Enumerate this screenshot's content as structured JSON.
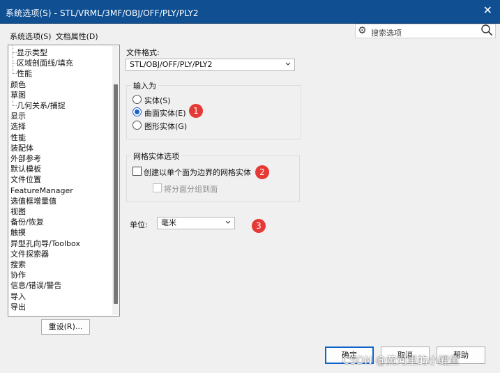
{
  "window": {
    "title": "系统选项(S) - STL/VRML/3MF/OBJ/OFF/PLY/PLY2",
    "close_glyph": "✕"
  },
  "tabs": [
    "系统选项(S)",
    "文档属性(D)"
  ],
  "search": {
    "placeholder": "搜索选项"
  },
  "tree": {
    "items": [
      {
        "label": "显示类型",
        "level": 1
      },
      {
        "label": "区域剖面线/填充",
        "level": 1
      },
      {
        "label": "性能",
        "level": 1
      },
      {
        "label": "颜色",
        "level": 0
      },
      {
        "label": "草图",
        "level": 0
      },
      {
        "label": "几何关系/捕捉",
        "level": 1
      },
      {
        "label": "显示",
        "level": 0
      },
      {
        "label": "选择",
        "level": 0
      },
      {
        "label": "性能",
        "level": 0
      },
      {
        "label": "装配体",
        "level": 0
      },
      {
        "label": "外部参考",
        "level": 0
      },
      {
        "label": "默认模板",
        "level": 0
      },
      {
        "label": "文件位置",
        "level": 0
      },
      {
        "label": "FeatureManager",
        "level": 0
      },
      {
        "label": "选值框增量值",
        "level": 0
      },
      {
        "label": "视图",
        "level": 0
      },
      {
        "label": "备份/恢复",
        "level": 0
      },
      {
        "label": "触摸",
        "level": 0
      },
      {
        "label": "异型孔向导/Toolbox",
        "level": 0
      },
      {
        "label": "文件探索器",
        "level": 0
      },
      {
        "label": "搜索",
        "level": 0
      },
      {
        "label": "协作",
        "level": 0
      },
      {
        "label": "信息/错误/警告",
        "level": 0
      },
      {
        "label": "导入",
        "level": 0
      },
      {
        "label": "导出",
        "level": 0
      }
    ],
    "reset_label": "重设(R)..."
  },
  "file_format": {
    "label": "文件格式:",
    "value": "STL/OBJ/OFF/PLY/PLY2"
  },
  "input_group": {
    "legend": "输入为",
    "options": [
      {
        "label": "实体(S)",
        "selected": false
      },
      {
        "label": "曲面实体(E)",
        "selected": true
      },
      {
        "label": "图形实体(G)",
        "selected": false
      }
    ]
  },
  "mesh_group": {
    "legend": "网格实体选项",
    "create_label": "创建以单个面为边界的网格实体",
    "group_label": "将分面分组到面"
  },
  "units": {
    "label": "单位:",
    "value": "毫米"
  },
  "badges": [
    "1",
    "2",
    "3"
  ],
  "buttons": {
    "ok": "确定",
    "cancel": "取消",
    "help": "帮助"
  },
  "watermark": "CSDN @黄河里的小鲤鱼",
  "colors": {
    "titlebar": "#0f4f92",
    "accent": "#1e5fc8",
    "badge": "#e53935"
  }
}
